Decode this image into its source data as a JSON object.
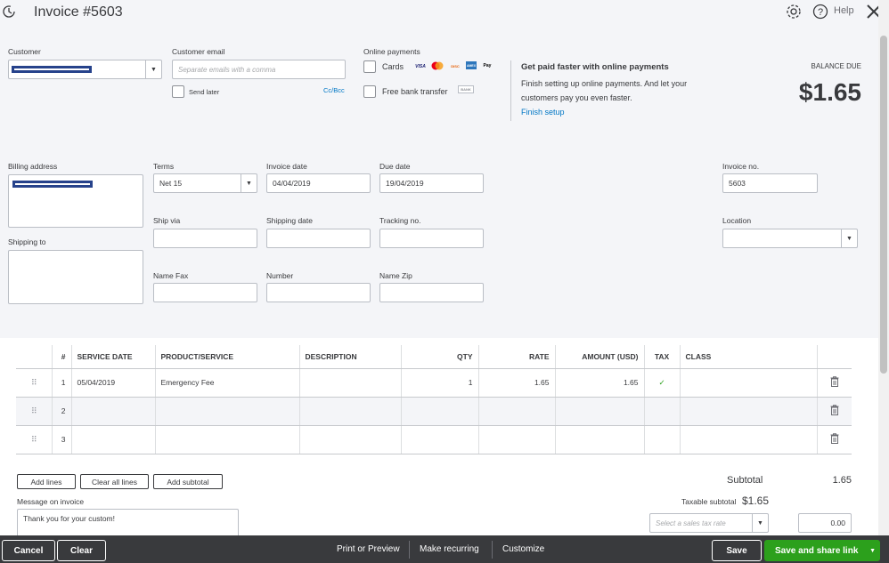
{
  "header": {
    "title": "Invoice #5603",
    "help_label": "Help"
  },
  "customer": {
    "label": "Customer"
  },
  "email": {
    "label": "Customer email",
    "placeholder": "Separate emails with a comma",
    "send_later": "Send later",
    "cc_bcc": "Cc/Bcc"
  },
  "payments": {
    "label": "Online payments",
    "cards": "Cards",
    "bank": "Free bank transfer",
    "card_icons": [
      "VISA",
      "MC",
      "DISC",
      "AMEX",
      "Pay"
    ],
    "bank_icon": "BANK"
  },
  "promo": {
    "title": "Get paid faster with online payments",
    "body": "Finish setting up online payments. And let your customers pay you even faster.",
    "link": "Finish setup"
  },
  "balance": {
    "label": "BALANCE DUE",
    "amount": "$1.65"
  },
  "fields": {
    "billing_address": "Billing address",
    "shipping_to": "Shipping to",
    "terms": "Terms",
    "terms_value": "Net 15",
    "invoice_date": "Invoice date",
    "invoice_date_value": "04/04/2019",
    "due_date": "Due date",
    "due_date_value": "19/04/2019",
    "invoice_no": "Invoice no.",
    "invoice_no_value": "5603",
    "ship_via": "Ship via",
    "shipping_date": "Shipping date",
    "tracking_no": "Tracking no.",
    "location": "Location",
    "name_fax": "Name Fax",
    "number": "Number",
    "name_zip": "Name Zip"
  },
  "table": {
    "headers": [
      "#",
      "SERVICE DATE",
      "PRODUCT/SERVICE",
      "DESCRIPTION",
      "QTY",
      "RATE",
      "AMOUNT (USD)",
      "TAX",
      "CLASS"
    ],
    "rows": [
      {
        "num": "1",
        "date": "05/04/2019",
        "product": "Emergency Fee",
        "desc": "",
        "qty": "1",
        "rate": "1.65",
        "amount": "1.65",
        "tax": "✓",
        "class": ""
      },
      {
        "num": "2",
        "date": "",
        "product": "",
        "desc": "",
        "qty": "",
        "rate": "",
        "amount": "",
        "tax": "",
        "class": ""
      },
      {
        "num": "3",
        "date": "",
        "product": "",
        "desc": "",
        "qty": "",
        "rate": "",
        "amount": "",
        "tax": "",
        "class": ""
      }
    ]
  },
  "actions": {
    "add_lines": "Add lines",
    "clear_all": "Clear all lines",
    "add_subtotal": "Add subtotal"
  },
  "message": {
    "label": "Message on invoice",
    "value": "Thank you for your custom!"
  },
  "totals": {
    "subtotal_label": "Subtotal",
    "subtotal_value": "1.65",
    "taxable_label": "Taxable subtotal",
    "taxable_value": "$1.65",
    "tax_placeholder": "Select a sales tax rate",
    "tax_amount": "0.00"
  },
  "footer": {
    "cancel": "Cancel",
    "clear": "Clear",
    "print": "Print or Preview",
    "recurring": "Make recurring",
    "customize": "Customize",
    "save": "Save",
    "save_share": "Save and share link"
  }
}
